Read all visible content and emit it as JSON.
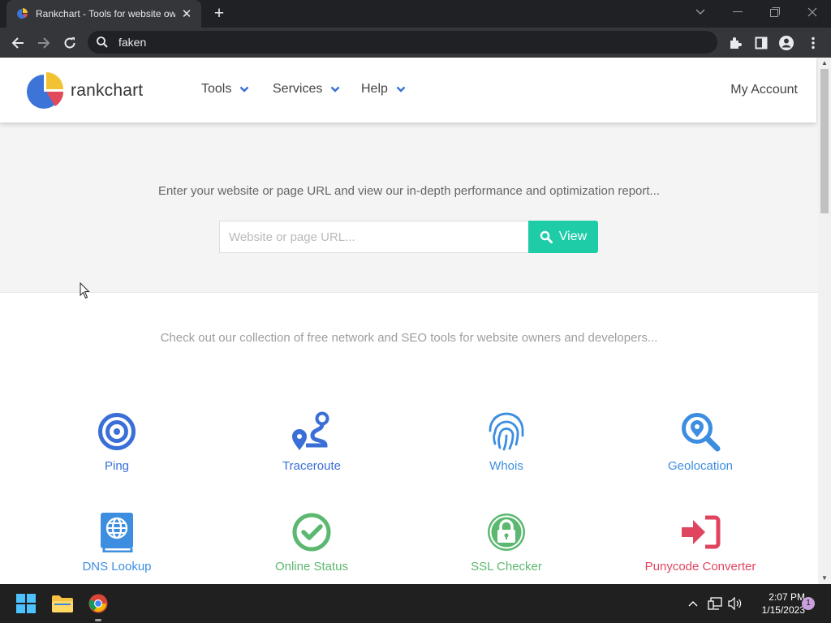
{
  "browser": {
    "tab_title": "Rankchart - Tools for website owners",
    "address": "faken"
  },
  "site": {
    "logo_text": "rankchart",
    "nav": [
      {
        "label": "Tools"
      },
      {
        "label": "Services"
      },
      {
        "label": "Help"
      }
    ],
    "account_label": "My Account",
    "hero_text": "Enter your website or page URL and view our in-depth performance and optimization report...",
    "url_placeholder": "Website or page URL...",
    "view_button": "View",
    "tools_intro": "Check out our collection of free network and SEO tools for website owners and developers...",
    "tools": [
      {
        "label": "Ping",
        "icon": "target-icon",
        "color": "#3a6fd8"
      },
      {
        "label": "Traceroute",
        "icon": "route-icon",
        "color": "#3a6fd8"
      },
      {
        "label": "Whois",
        "icon": "fingerprint-icon",
        "color": "#3d8ee0"
      },
      {
        "label": "Geolocation",
        "icon": "search-location-icon",
        "color": "#3d8ee0"
      },
      {
        "label": "DNS Lookup",
        "icon": "globe-book-icon",
        "color": "#3d8ee0"
      },
      {
        "label": "Online Status",
        "icon": "check-circle-icon",
        "color": "#5cb870"
      },
      {
        "label": "SSL Checker",
        "icon": "lock-circle-icon",
        "color": "#5cb870"
      },
      {
        "label": "Punycode Converter",
        "icon": "sign-in-icon",
        "color": "#e0455f"
      }
    ]
  },
  "taskbar": {
    "time": "2:07 PM",
    "date": "1/15/2023",
    "notifications": "1"
  }
}
